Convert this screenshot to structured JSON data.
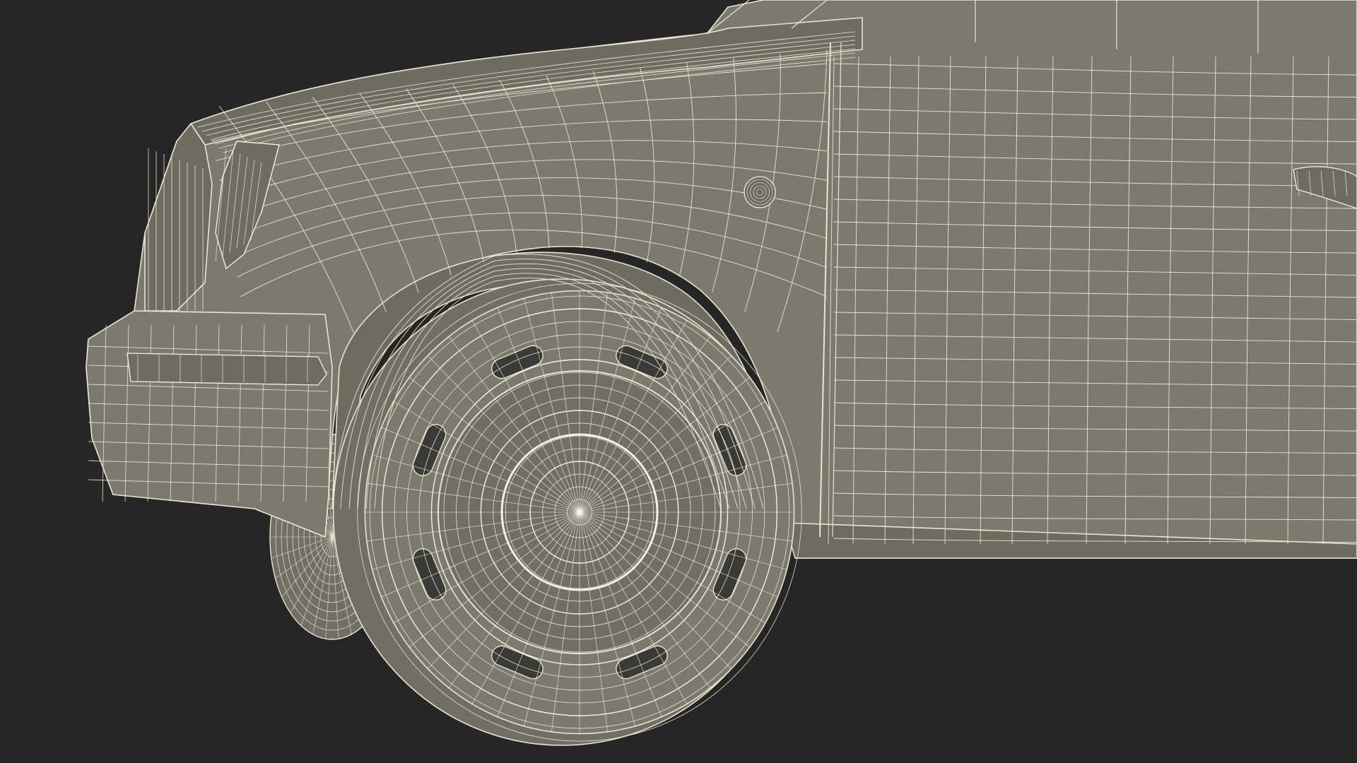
{
  "scene": {
    "subject": "car-front-wireframe-render",
    "colors": {
      "background": "#262626",
      "body_fill": "#7a7a6e",
      "body_shade": "#6c6c61",
      "tire_fill": "#6f6f65",
      "dark_fill": "#3a3a36",
      "wire": "#e6e6d0",
      "wire_dense": "#f2f2de"
    }
  }
}
